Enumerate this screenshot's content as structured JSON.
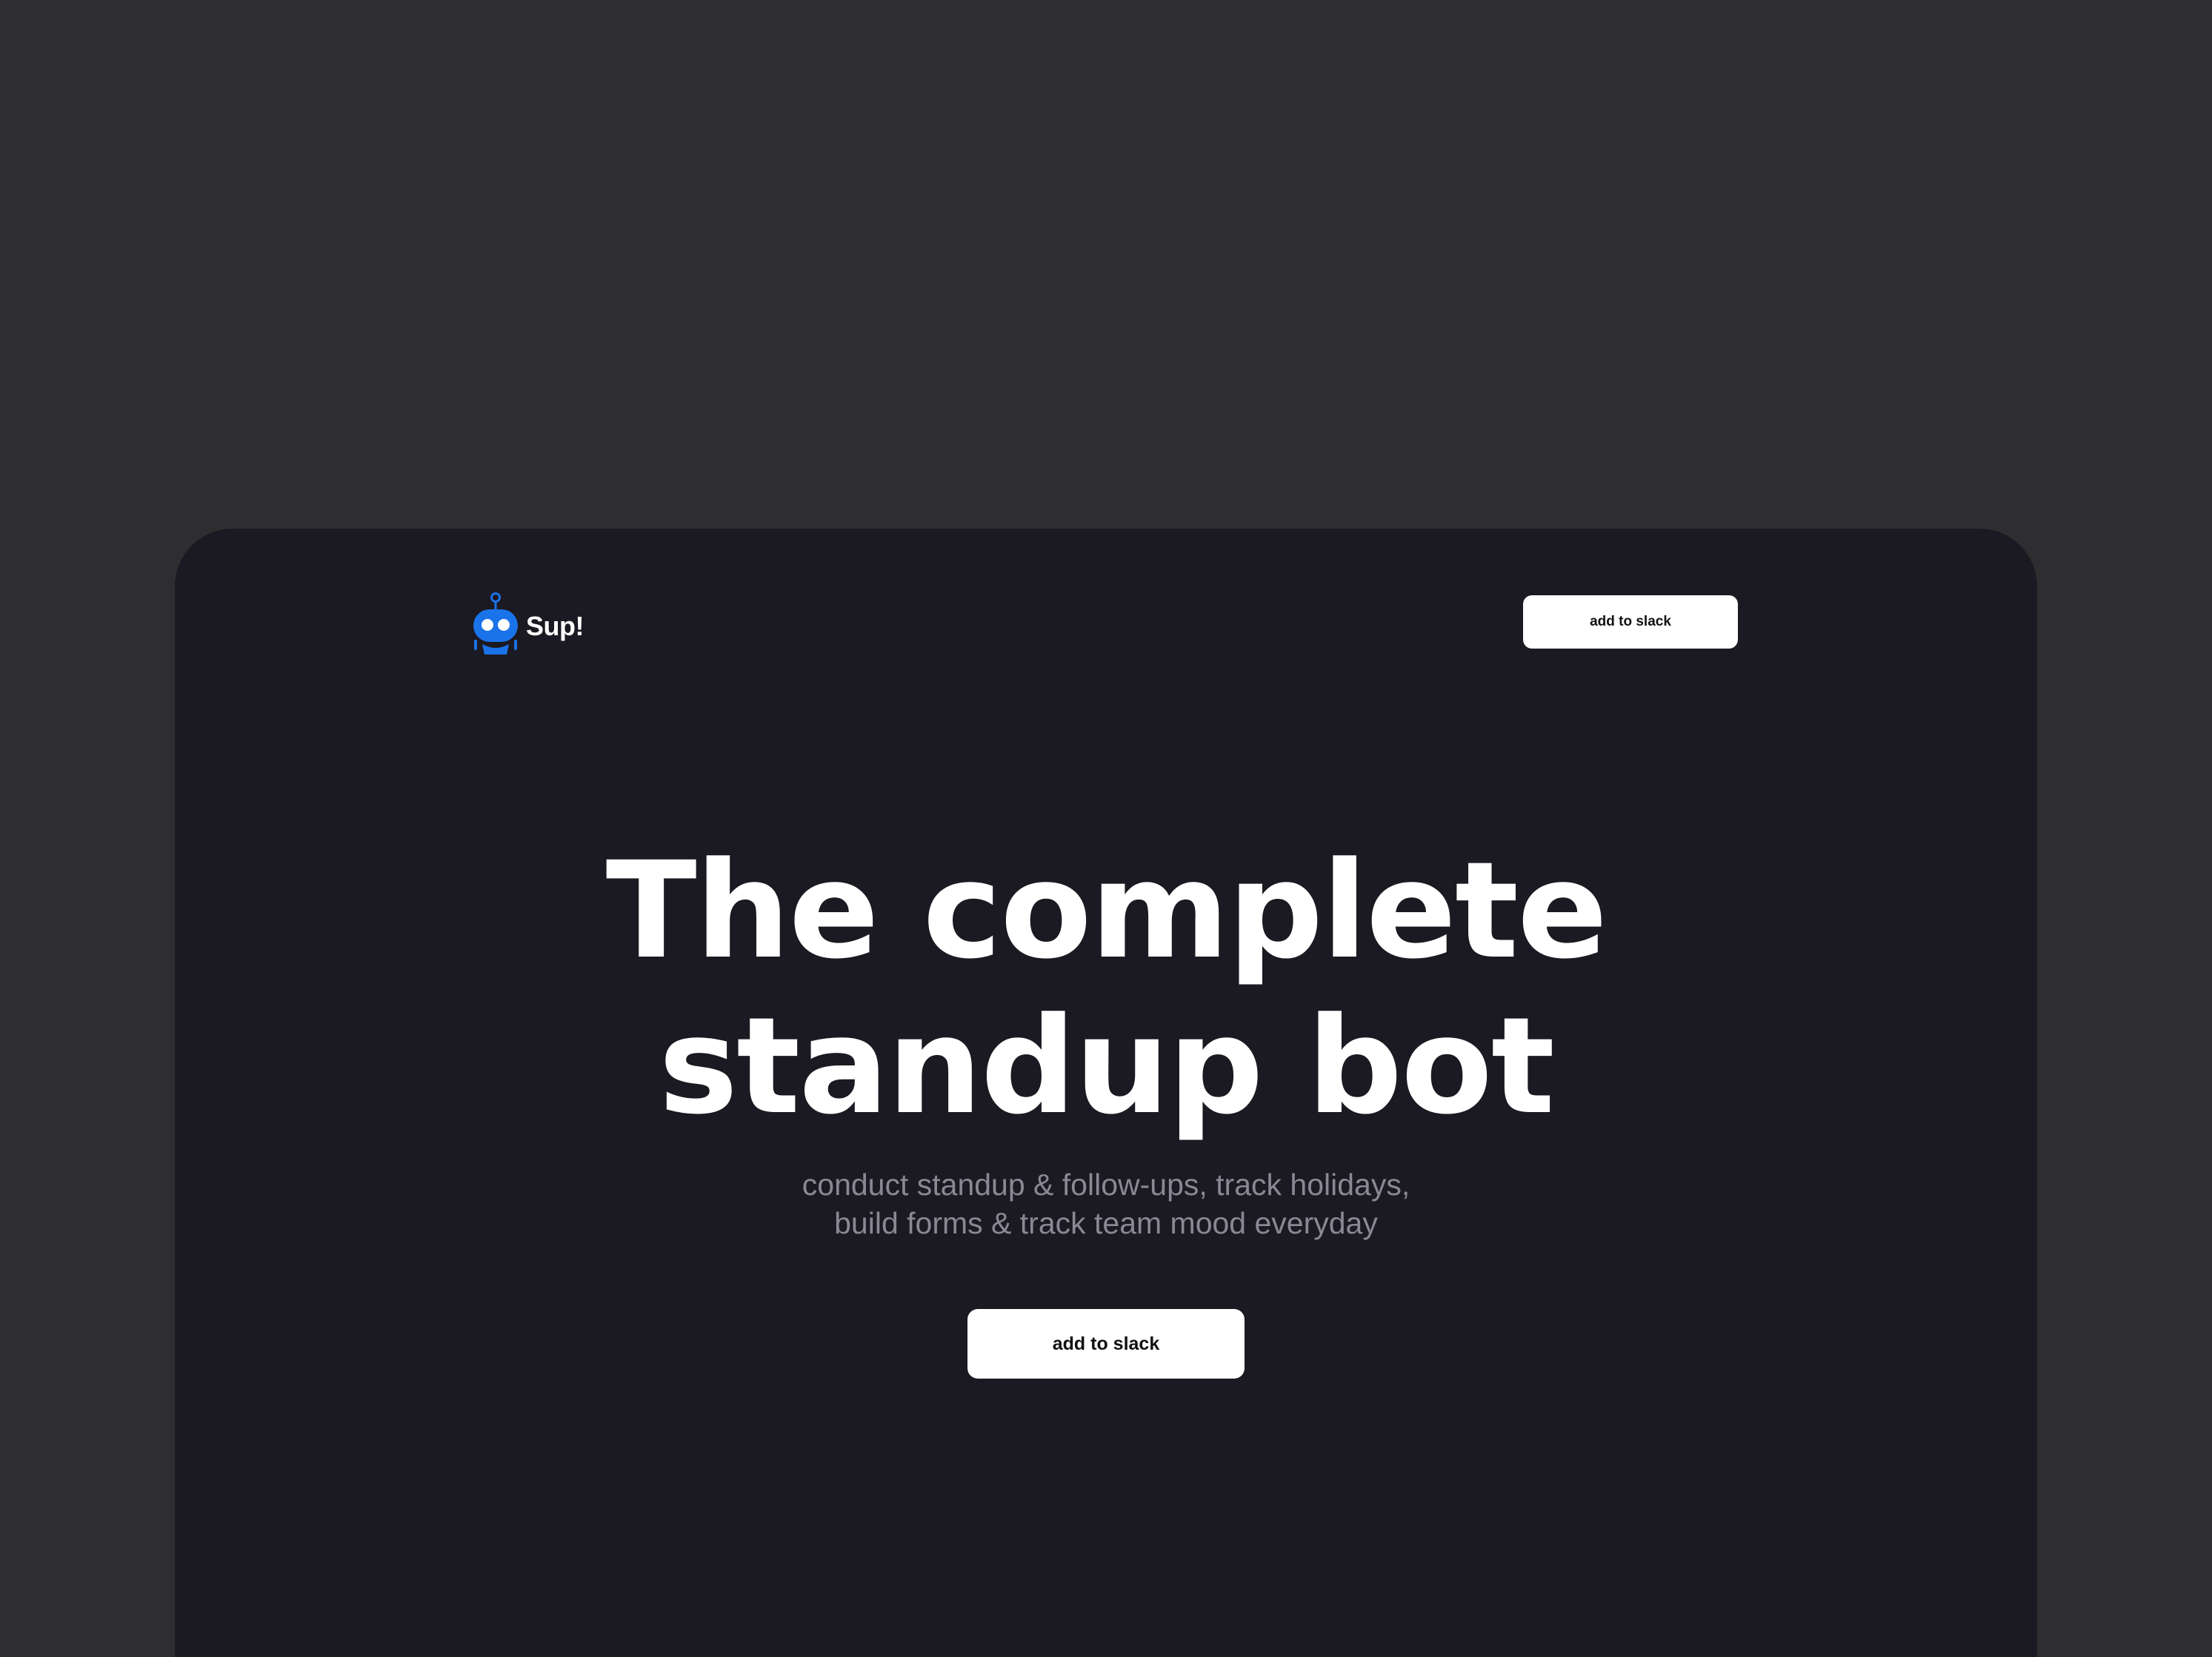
{
  "brand": {
    "name": "Sup!",
    "logo_icon": "robot-icon",
    "accent_color": "#1a73e8"
  },
  "nav": {
    "cta_label": "add to slack"
  },
  "hero": {
    "title_line1": "The complete",
    "title_line2": "standup bot",
    "subtitle_line1": "conduct standup & follow-ups, track holidays,",
    "subtitle_line2": "build forms & track team mood everyday",
    "cta_label": "add to slack"
  },
  "colors": {
    "outer_background": "#2e2e30",
    "frame_background": "#1b1921",
    "title_text": "#ffffff",
    "subtitle_text": "#8a8893",
    "button_background": "#ffffff",
    "button_text": "#111111"
  }
}
